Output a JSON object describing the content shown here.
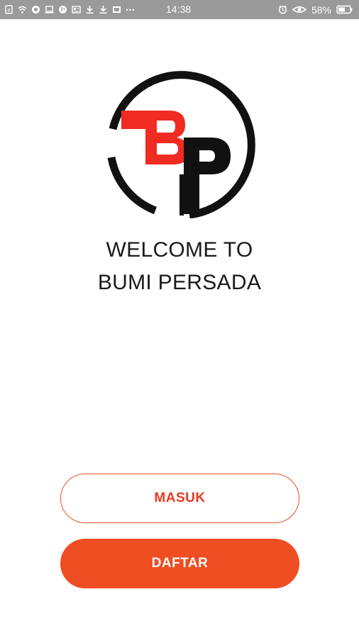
{
  "status_bar": {
    "time": "14:38",
    "battery": "58%",
    "left_icons": [
      "sim-icon",
      "wifi-icon",
      "vpn-icon",
      "laptop-icon",
      "globe-icon",
      "news-icon",
      "download-icon",
      "download-icon",
      "photo-icon",
      "more-icon"
    ],
    "right_icons": [
      "alarm-icon",
      "eye-icon",
      "battery-icon"
    ],
    "background": "#9a9a9a"
  },
  "logo": {
    "letters": "BP",
    "ring_color": "#111111",
    "accent_color": "#ef2b22"
  },
  "welcome": {
    "line1": "WELCOME TO",
    "line2": "BUMI PERSADA"
  },
  "buttons": {
    "masuk_label": "MASUK",
    "daftar_label": "DAFTAR"
  },
  "colors": {
    "accent": "#ef4d22",
    "text": "#1a1a1a"
  }
}
